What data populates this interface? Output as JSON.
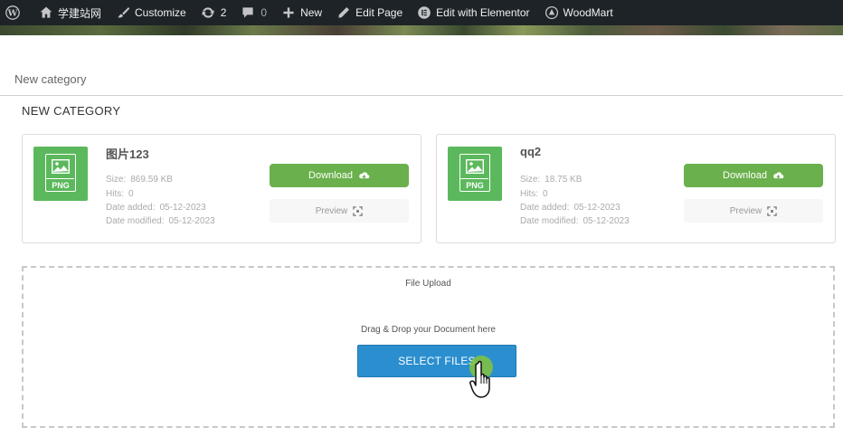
{
  "admin_bar": {
    "site_name": "学建站网",
    "customize": "Customize",
    "updates_count": "2",
    "comments_count": "0",
    "new_label": "New",
    "edit_page": "Edit Page",
    "edit_elementor": "Edit with Elementor",
    "woodmart": "WoodMart"
  },
  "page": {
    "title": "New category",
    "section_heading": "NEW CATEGORY"
  },
  "labels": {
    "size": "Size:",
    "hits": "Hits:",
    "date_added": "Date added:",
    "date_modified": "Date modified:",
    "download": "Download",
    "preview": "Preview"
  },
  "files": [
    {
      "name": "图片123",
      "ext": "PNG",
      "size": "869.59 KB",
      "hits": "0",
      "date_added": "05-12-2023",
      "date_modified": "05-12-2023"
    },
    {
      "name": "qq2",
      "ext": "PNG",
      "size": "18.75 KB",
      "hits": "0",
      "date_added": "05-12-2023",
      "date_modified": "05-12-2023"
    }
  ],
  "upload": {
    "title": "File Upload",
    "hint": "Drag & Drop your Document here",
    "button": "SELECT FILES"
  },
  "colors": {
    "admin_bar_bg": "#1d2327",
    "thumb_green": "#5cb85c",
    "download_green": "#6ab04c",
    "select_blue": "#2b8fcf"
  },
  "icons": {
    "admin": [
      "wordpress-icon",
      "home-icon",
      "brush-icon",
      "updates-icon",
      "comment-icon",
      "plus-icon",
      "pencil-icon",
      "elementor-icon",
      "woodmart-icon"
    ],
    "card": [
      "image-icon",
      "cloud-download-icon",
      "expand-icon"
    ],
    "pointer": "hand-cursor-icon"
  }
}
